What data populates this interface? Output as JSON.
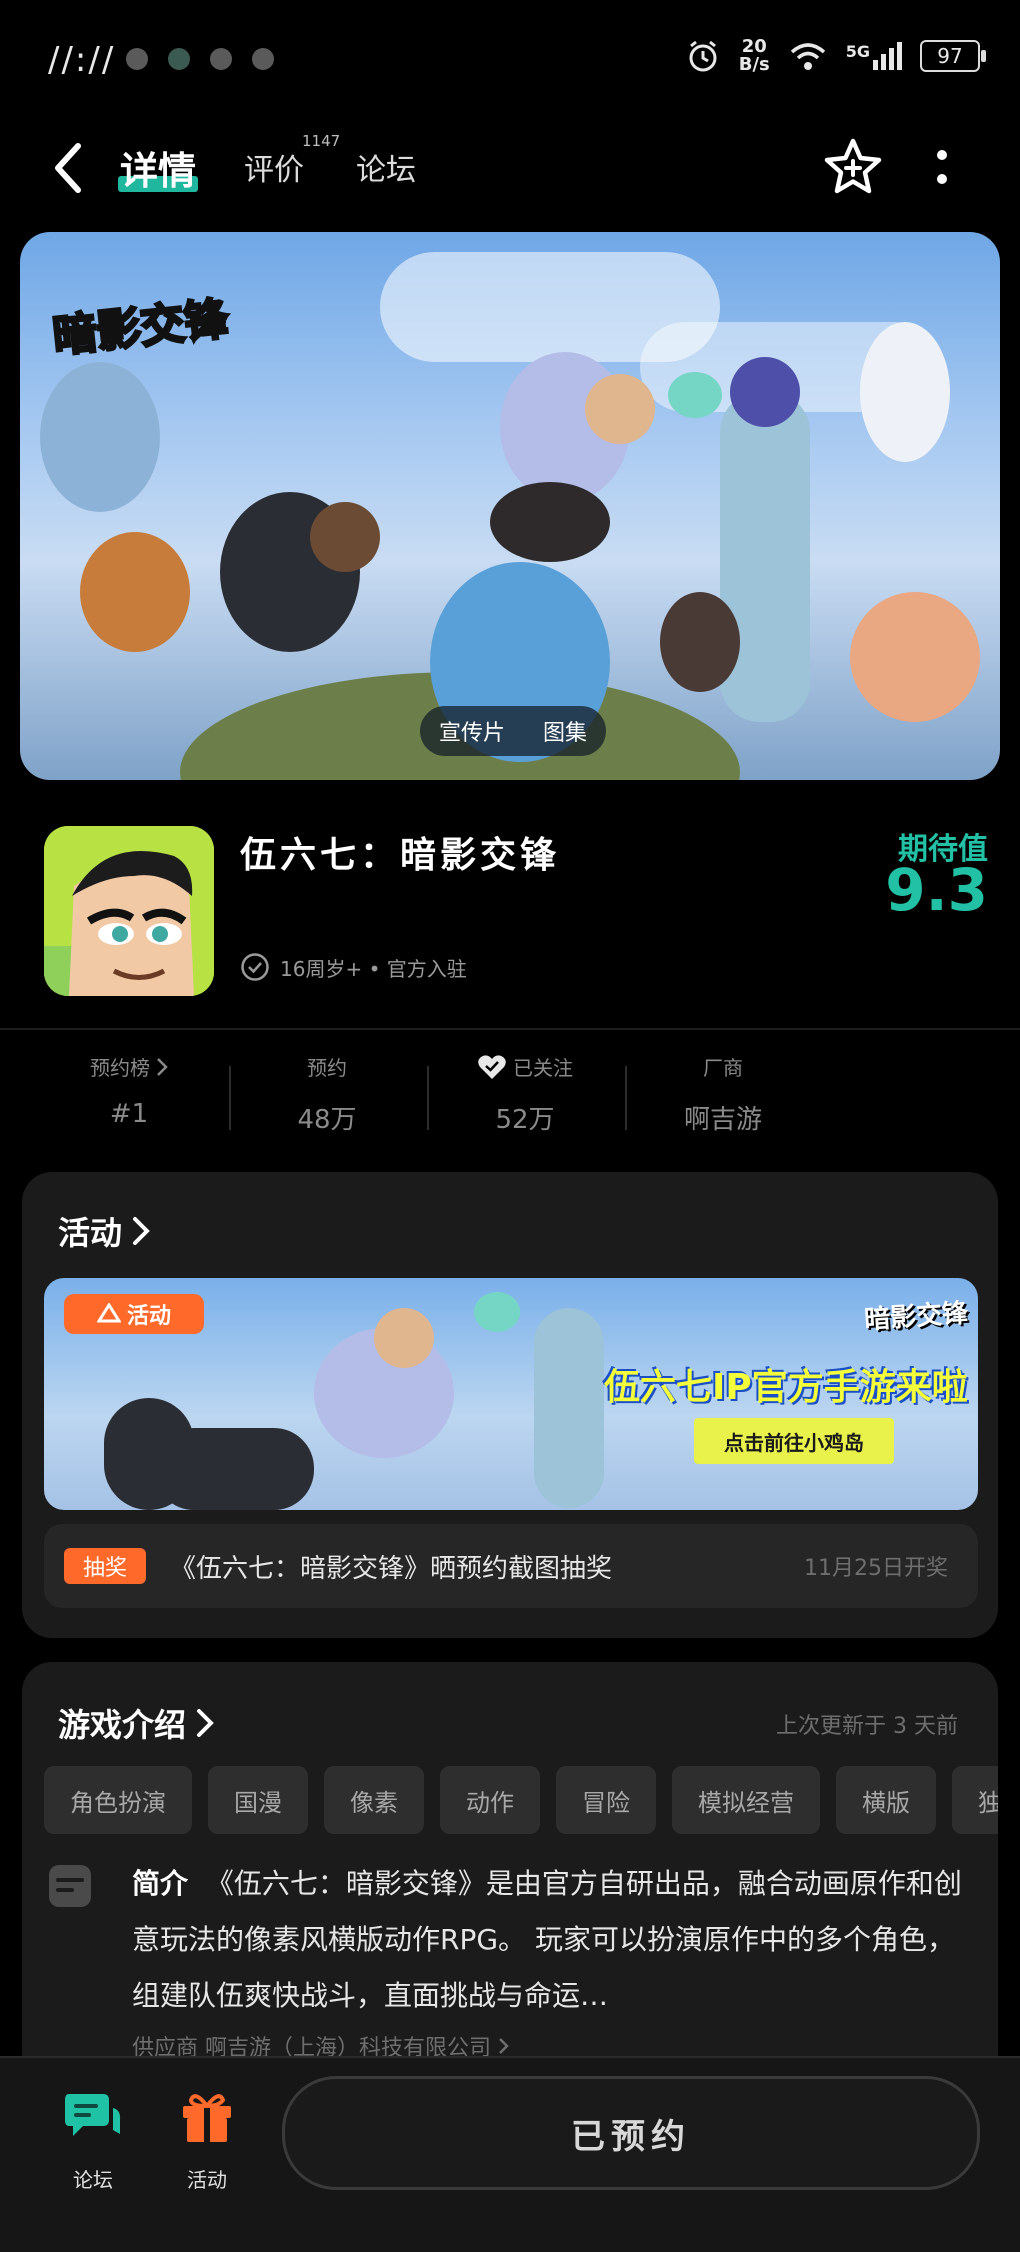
{
  "status_bar": {
    "time": "//://",
    "net_speed_top": "20",
    "net_speed_bottom": "B/s",
    "signal_label": "5G",
    "battery": "97"
  },
  "nav": {
    "tabs": [
      {
        "label": "详情"
      },
      {
        "label": "评价",
        "badge": "1147"
      },
      {
        "label": "论坛"
      }
    ]
  },
  "hero": {
    "logo_text": "暗影交锋",
    "chips": [
      "宣传片",
      "图集"
    ]
  },
  "game": {
    "title": "伍六七：暗影交锋",
    "official_text": "16周岁+ • 官方入驻",
    "expect_label": "期待值",
    "expect_value": "9.3"
  },
  "stats": [
    {
      "label": "预约榜",
      "value": "#1"
    },
    {
      "label": "预约",
      "value": "48万"
    },
    {
      "label": "已关注",
      "value": "52万"
    },
    {
      "label": "厂商",
      "value": "啊吉游"
    }
  ],
  "activity": {
    "title": "活动",
    "banner_tag": "活动",
    "banner_logo": "暗影交锋",
    "banner_headline": "伍六七IP官方手游来啦",
    "banner_cta": "点击前往小鸡岛",
    "lottery_tag": "抽奖",
    "lottery_text": "《伍六七：暗影交锋》晒预约截图抽奖",
    "lottery_date": "11月25日开奖"
  },
  "intro": {
    "title": "游戏介绍",
    "updated": "上次更新于 3 天前",
    "tags": [
      "角色扮演",
      "国漫",
      "像素",
      "动作",
      "冒险",
      "模拟经营",
      "横版",
      "独"
    ],
    "label": "简介",
    "text": "《伍六七：暗影交锋》是由官方自研出品，融合动画原作和创意玩法的像素风横版动作RPG。 玩家可以扮演原作中的多个角色，组建队伍爽快战斗，直面挑战与命运…",
    "supplier": "供应商 啊吉游（上海）科技有限公司"
  },
  "bottom": {
    "forum_label": "论坛",
    "activity_label": "活动",
    "reserve_label": "已预约"
  },
  "colors": {
    "accent": "#1fb89f",
    "orange": "#ff6a2b"
  }
}
